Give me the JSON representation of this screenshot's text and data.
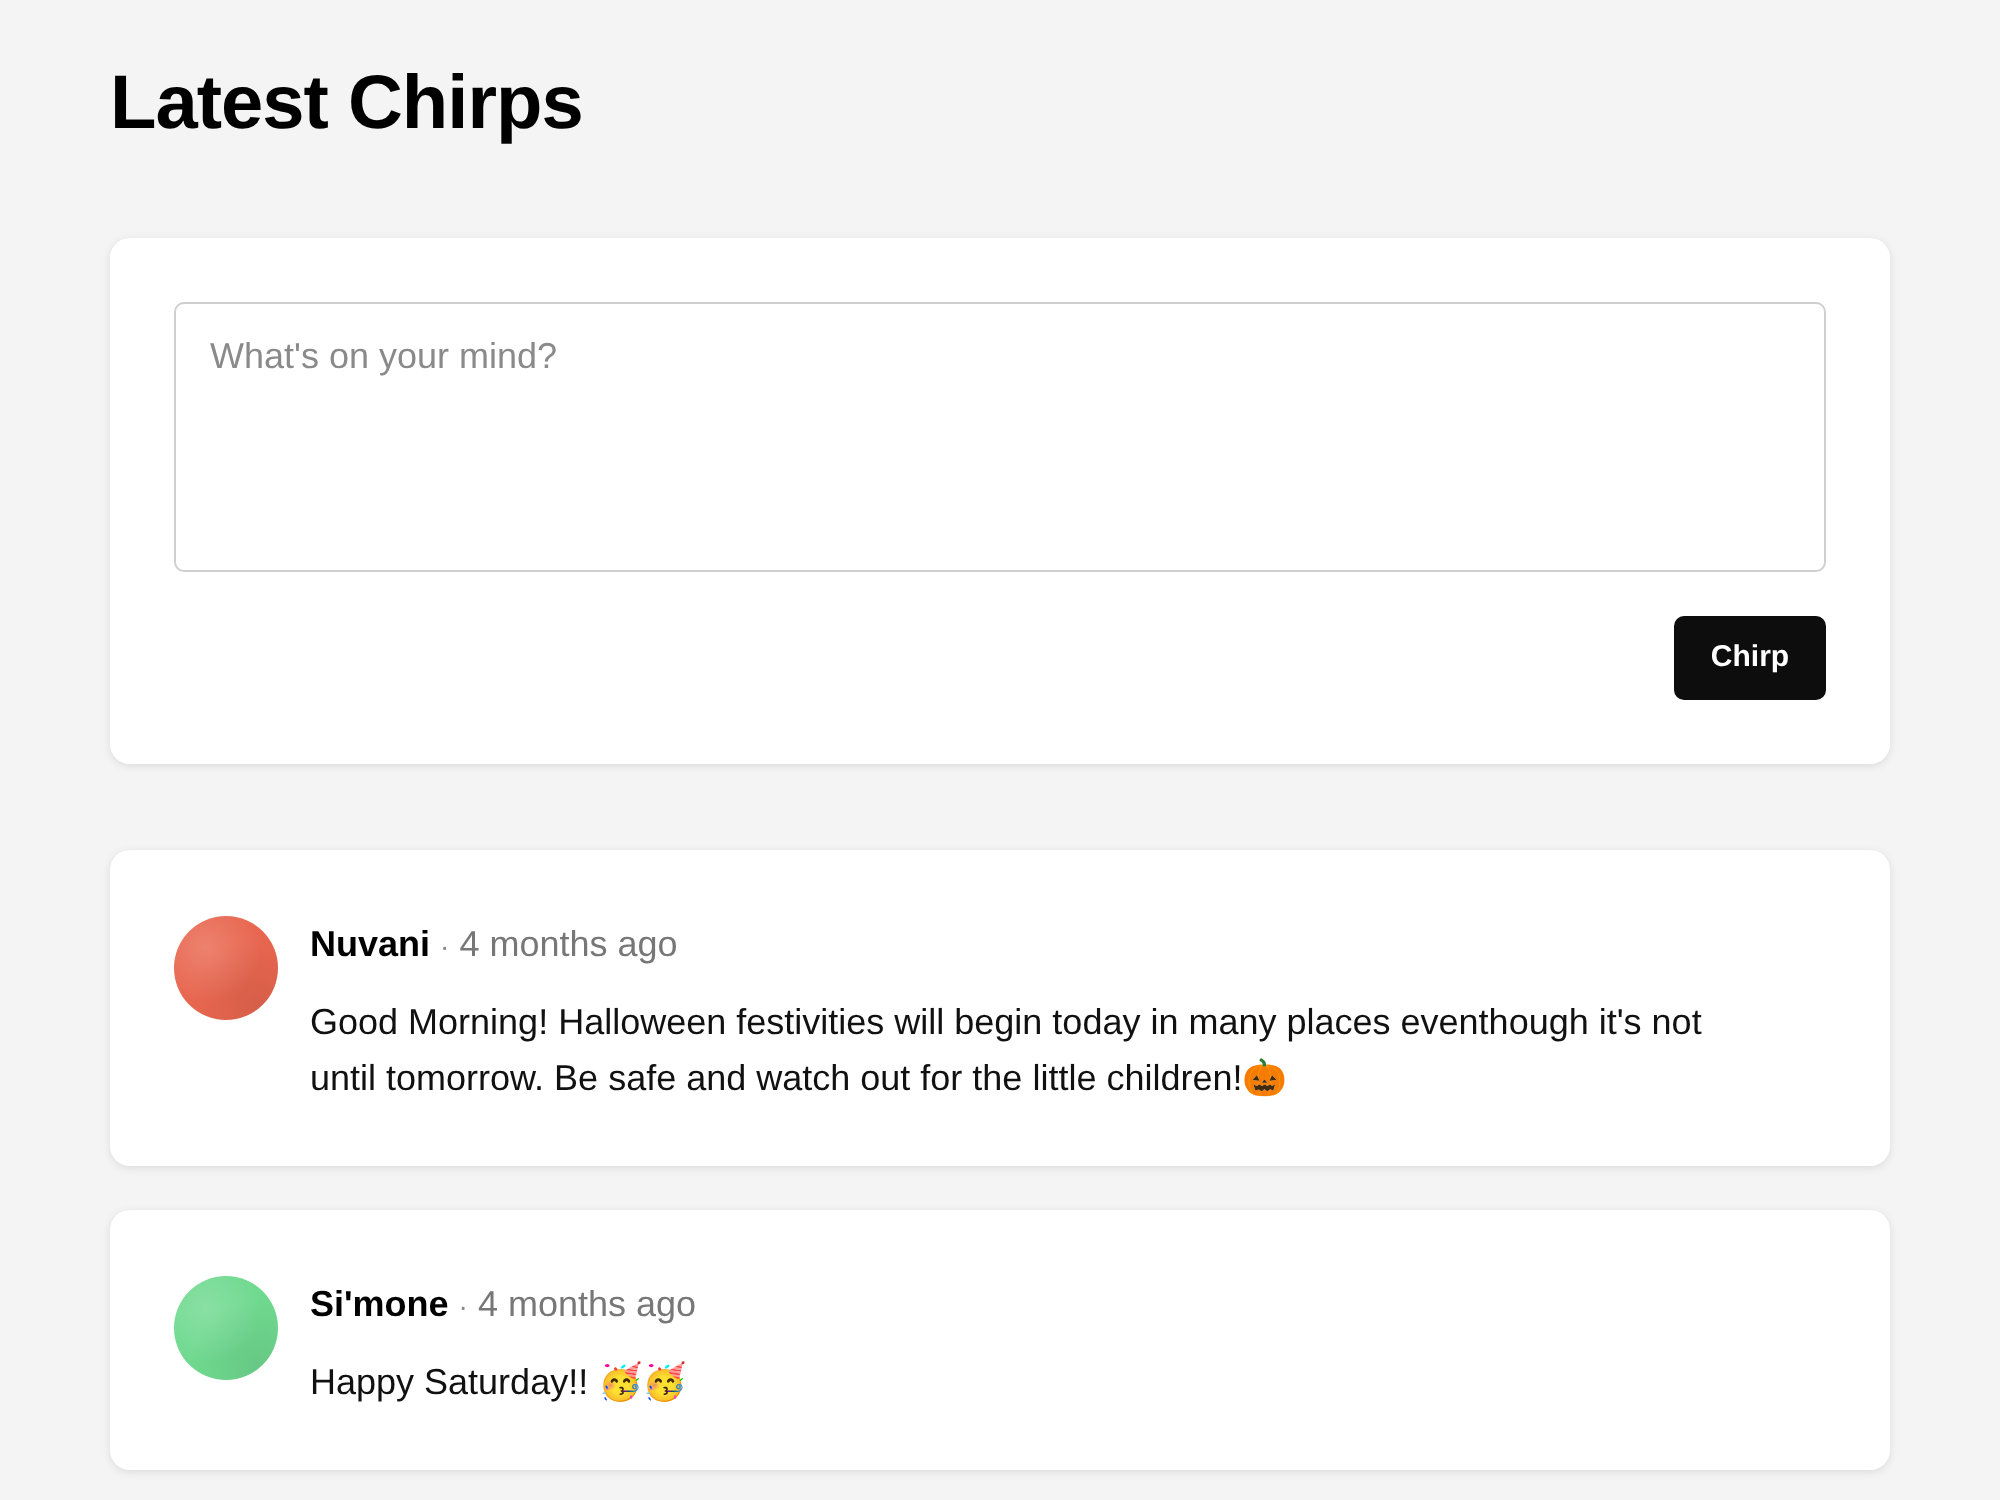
{
  "page": {
    "title": "Latest Chirps"
  },
  "composer": {
    "placeholder": "What's on your mind?",
    "button": "Chirp"
  },
  "chirps": [
    {
      "author": "Nuvani",
      "separator": "·",
      "time": "4 months ago",
      "text": "Good Morning! Halloween festivities will begin today in many places eventhough it's not until tomorrow. Be safe and watch out for the little children!🎃",
      "color": "#e8664f"
    },
    {
      "author": "Si'mone",
      "separator": "·",
      "time": "4 months ago",
      "text": "Happy Saturday!! 🥳🥳",
      "color": "#6fd98f"
    }
  ]
}
